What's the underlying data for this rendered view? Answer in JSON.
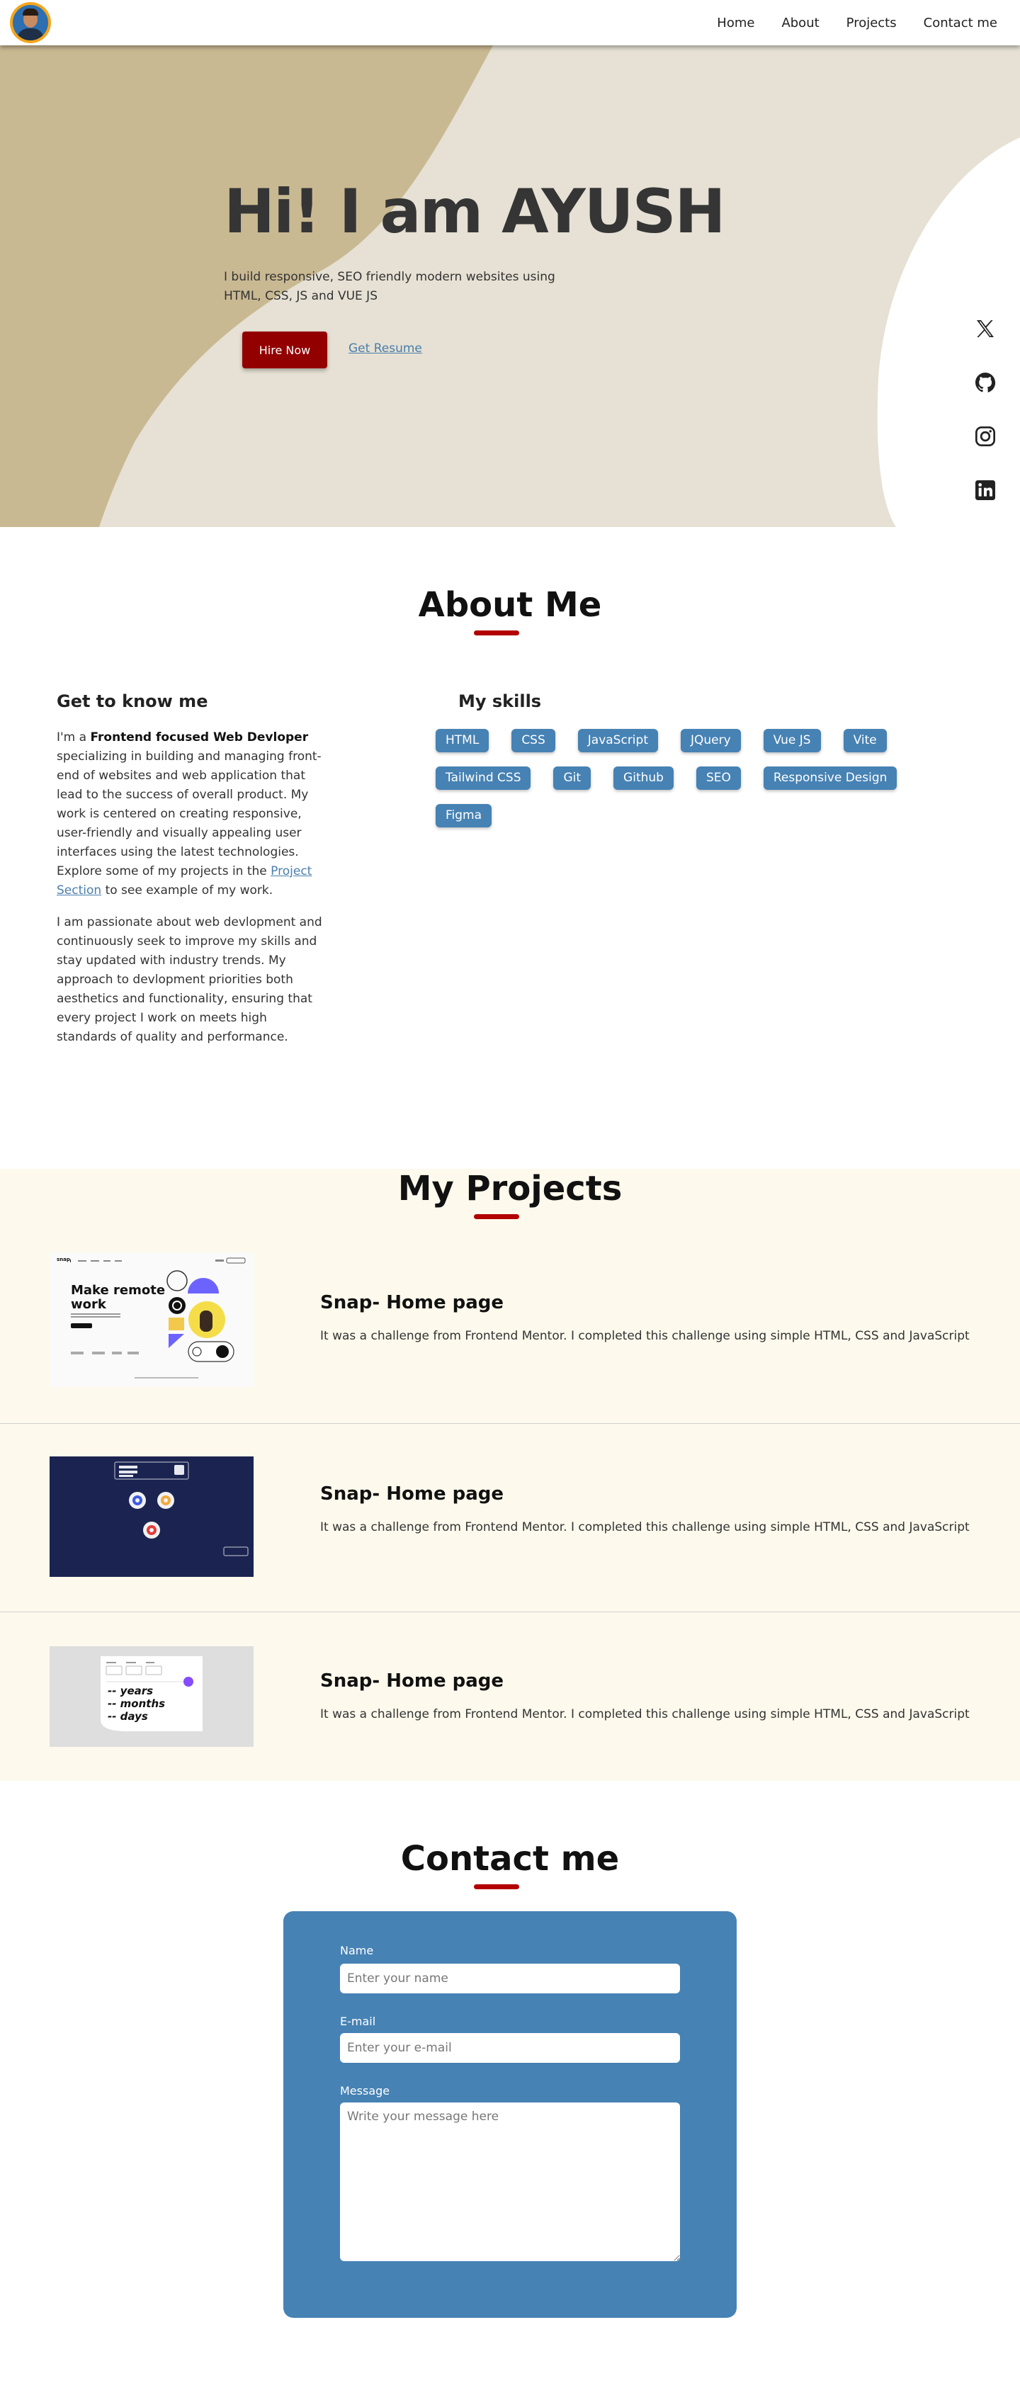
{
  "nav": {
    "links": [
      "Home",
      "About",
      "Projects",
      "Contact me"
    ]
  },
  "hero": {
    "title": "Hi! I am AYUSH",
    "subtitle": "I build responsive, SEO friendly modern websites using HTML, CSS, JS and VUE JS",
    "hire_label": "Hire Now",
    "resume_label": "Get Resume",
    "socials": [
      "x-icon",
      "github-icon",
      "instagram-icon",
      "linkedin-icon"
    ]
  },
  "about": {
    "title": "About Me",
    "left_heading": "Get to know me",
    "p1_pre": "I'm a ",
    "p1_bold": "Frontend focused Web Devloper",
    "p1_mid": " specializing in building and managing front-end of websites and web application that lead to the success of overall product. My work is centered on creating responsive, user-friendly and visually appealing user interfaces using the latest technologies. Explore some of my projects in the ",
    "p1_link": "Project Section",
    "p1_post": " to see example of my work.",
    "p2": "I am passionate about web devlopment and continuously seek to improve my skills and stay updated with industry trends. My approach to devlopment priorities both aesthetics and functionality, ensuring that every project I work on meets high standards of quality and performance.",
    "skills_heading": "My skills",
    "skills": [
      "HTML",
      "CSS",
      "JavaScript",
      "JQuery",
      "Vue JS",
      "Vite",
      "Tailwind CSS",
      "Git",
      "Github",
      "SEO",
      "Responsive Design",
      "Figma"
    ]
  },
  "projects": {
    "title": "My Projects",
    "items": [
      {
        "title": "Snap- Home page",
        "desc": "It was a challenge from Frontend Mentor. I completed this challenge using simple HTML, CSS and JavaScript"
      },
      {
        "title": "Snap- Home page",
        "desc": "It was a challenge from Frontend Mentor. I completed this challenge using simple HTML, CSS and JavaScript"
      },
      {
        "title": "Snap- Home page",
        "desc": "It was a challenge from Frontend Mentor. I completed this challenge using simple HTML, CSS and JavaScript"
      }
    ],
    "thumb1": {
      "logo": "snap",
      "headline": "Make remote work"
    },
    "thumb3": {
      "l1": "-- years",
      "l2": "-- months",
      "l3": "-- days"
    }
  },
  "contact": {
    "title": "Contact me",
    "name_label": "Name",
    "name_placeholder": "Enter your name",
    "email_label": "E-mail",
    "email_placeholder": "Enter your e-mail",
    "message_label": "Message",
    "message_placeholder": "Write your message here"
  },
  "colors": {
    "accent": "#930000",
    "skill": "#4682b4",
    "hero_bg": "#e6e1d4",
    "hero_shape": "#c9b992",
    "projects_bg": "#fdf9ec"
  }
}
